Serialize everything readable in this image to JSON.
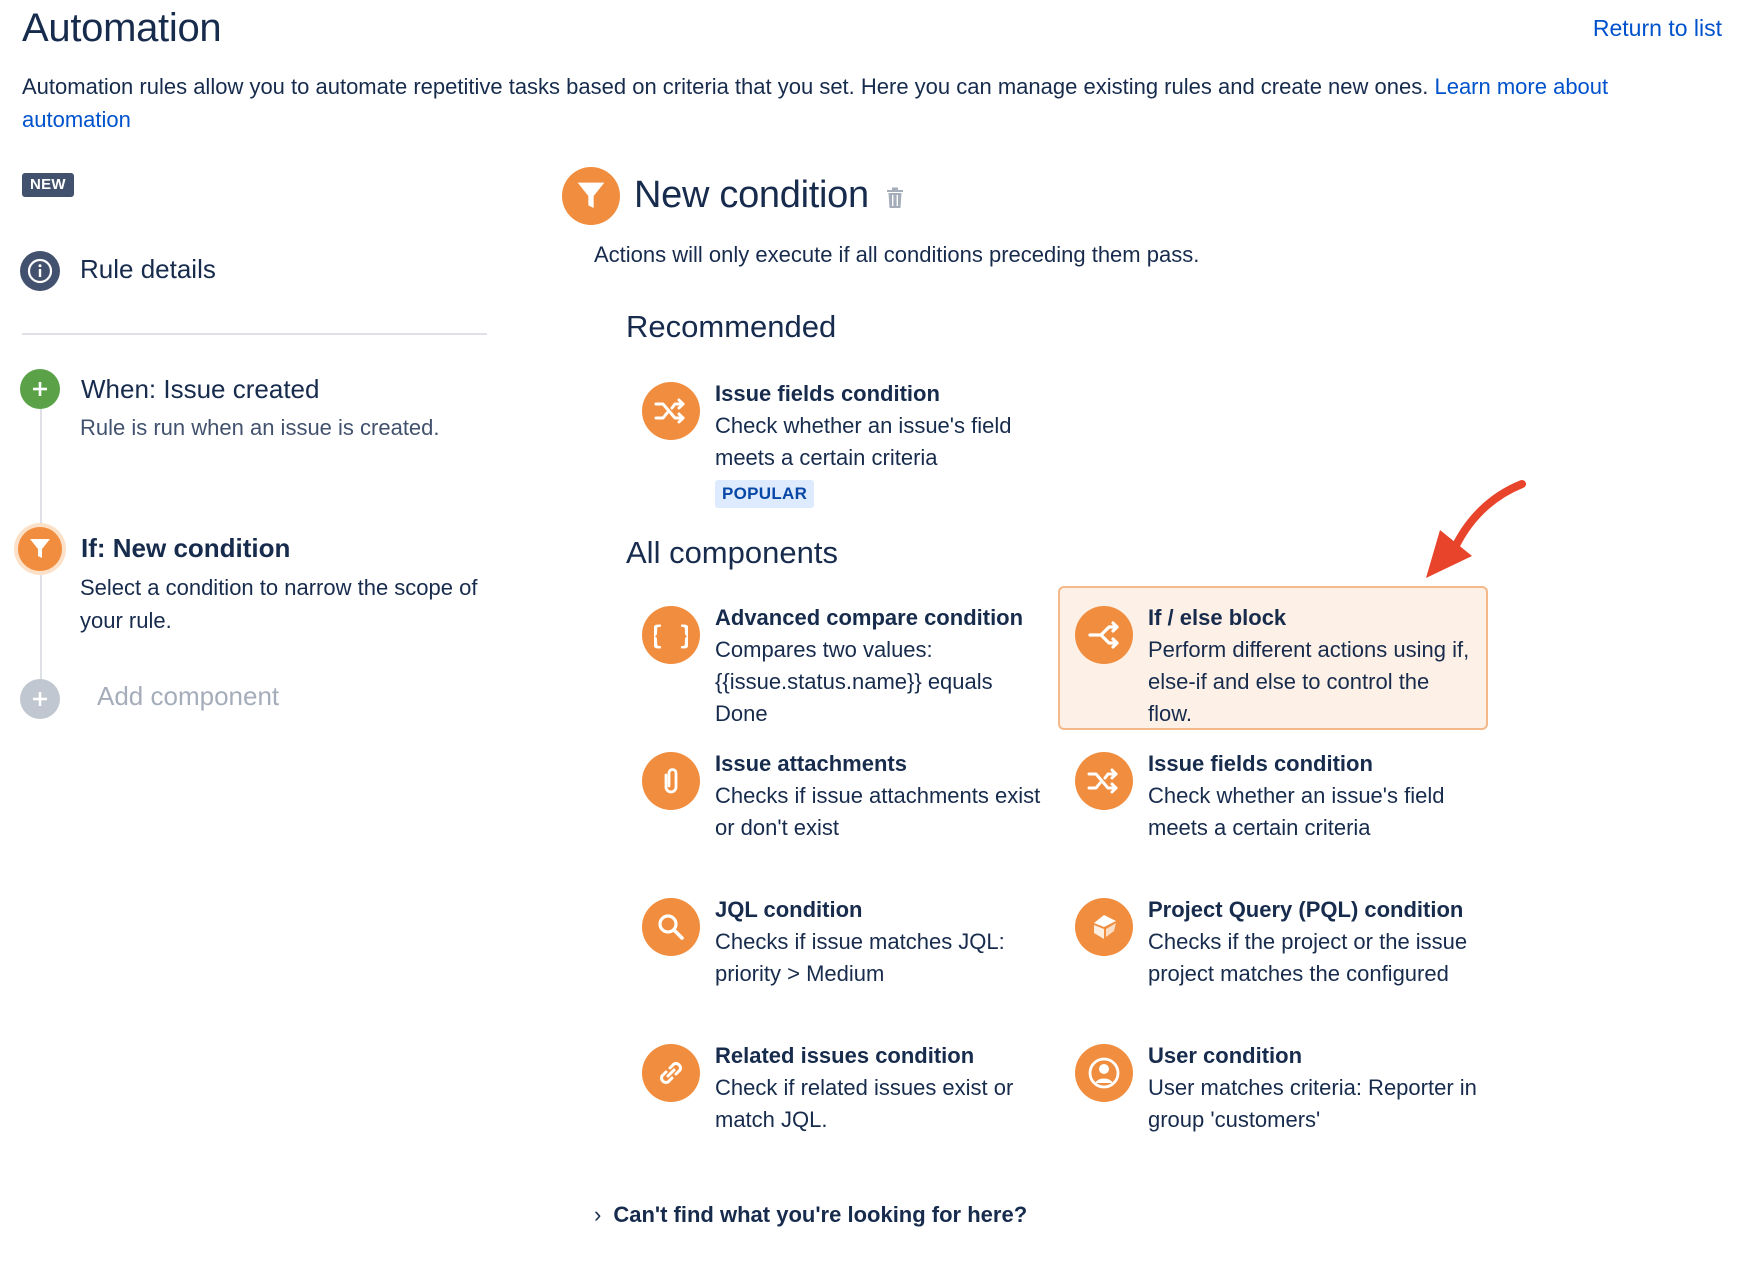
{
  "header": {
    "title": "Automation",
    "return_link": "Return to list",
    "intro_text": "Automation rules allow you to automate repetitive tasks based on criteria that you set. Here you can manage existing rules and create new ones.",
    "learn_more": "Learn more about automation"
  },
  "sidebar": {
    "badge": "NEW",
    "rule_details": "Rule details",
    "steps": [
      {
        "title": "When: Issue created",
        "desc": "Rule is run when an issue is created."
      },
      {
        "title": "If: New condition",
        "desc": "Select a condition to narrow the scope of your rule."
      }
    ],
    "add_component": "Add component"
  },
  "main": {
    "title": "New condition",
    "description": "Actions will only execute if all conditions preceding them pass.",
    "recommended_heading": "Recommended",
    "recommended": {
      "title": "Issue fields condition",
      "desc": "Check whether an issue's field meets a certain criteria",
      "badge": "POPULAR",
      "icon": "shuffle-icon"
    },
    "all_heading": "All components",
    "components": [
      {
        "title": "Advanced compare condition",
        "desc": "Compares two values: {{issue.status.name}} equals Done",
        "icon": "braces-icon"
      },
      {
        "title": "If / else block",
        "desc": "Perform different actions using if, else-if and else to control the flow.",
        "icon": "branch-icon"
      },
      {
        "title": "Issue attachments",
        "desc": "Checks if issue attachments exist or don't exist",
        "icon": "paperclip-icon"
      },
      {
        "title": "Issue fields condition",
        "desc": "Check whether an issue's field meets a certain criteria",
        "icon": "shuffle-icon"
      },
      {
        "title": "JQL condition",
        "desc": "Checks if issue matches JQL: priority > Medium",
        "icon": "search-icon"
      },
      {
        "title": "Project Query (PQL) condition",
        "desc": "Checks if the project or the issue project matches the configured",
        "icon": "project-icon"
      },
      {
        "title": "Related issues condition",
        "desc": "Check if related issues exist or match JQL.",
        "icon": "link-icon"
      },
      {
        "title": "User condition",
        "desc": "User matches criteria: Reporter in group 'customers'",
        "icon": "user-icon"
      }
    ],
    "cant_find": "Can't find what you're looking for here?"
  },
  "colors": {
    "accent_orange": "#f18d3e",
    "link_blue": "#0052cc",
    "success_green": "#5aa147",
    "annotation_red": "#e8432b"
  }
}
